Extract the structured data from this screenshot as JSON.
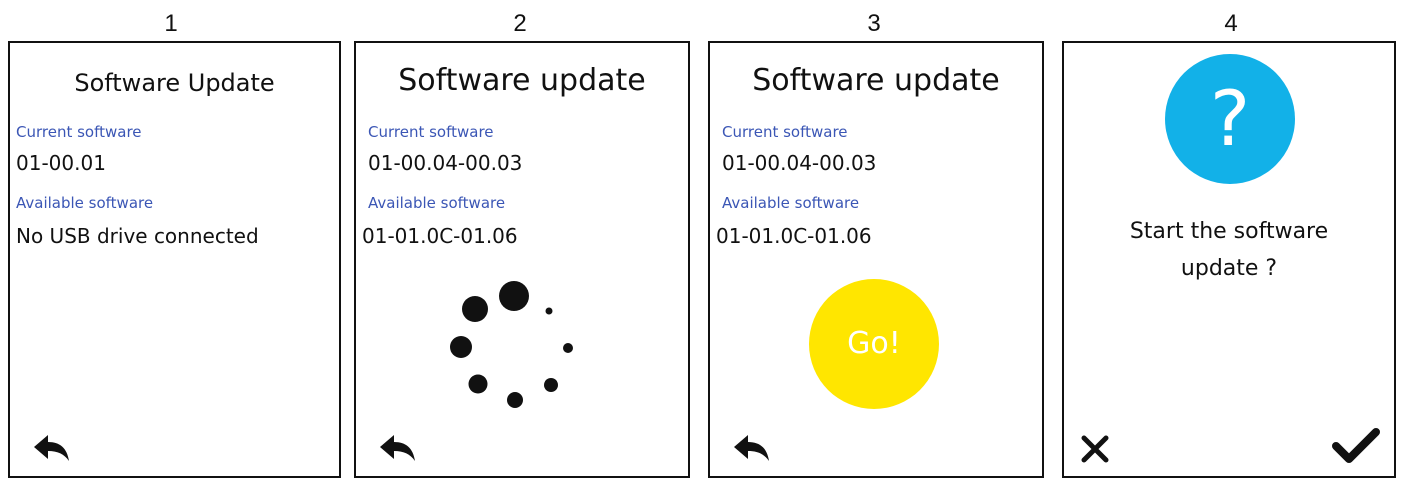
{
  "steps": [
    "1",
    "2",
    "3",
    "4"
  ],
  "screens": [
    {
      "title": "Software Update",
      "current_label": "Current software",
      "current_value": "01-00.01",
      "available_label": "Available software",
      "available_value": "No USB drive connected",
      "back_icon": "back-arrow-icon"
    },
    {
      "title": "Software update",
      "current_label": "Current software",
      "current_value": "01-00.04-00.03",
      "available_label": "Available software",
      "available_value": "01-01.0C-01.06",
      "loading_icon": "loading-spinner-icon",
      "back_icon": "back-arrow-icon"
    },
    {
      "title": "Software update",
      "current_label": "Current software",
      "current_value": "01-00.04-00.03",
      "available_label": "Available software",
      "available_value": "01-01.0C-01.06",
      "go_label": "Go!",
      "back_icon": "back-arrow-icon"
    },
    {
      "question_mark": "?",
      "prompt_line1": "Start the software",
      "prompt_line2": "update ?",
      "cancel_icon": "close-icon",
      "confirm_icon": "checkmark-icon"
    }
  ],
  "colors": {
    "label_blue": "#3b56b5",
    "go_yellow": "#ffe600",
    "question_cyan": "#12b1e8",
    "border": "#111111"
  }
}
